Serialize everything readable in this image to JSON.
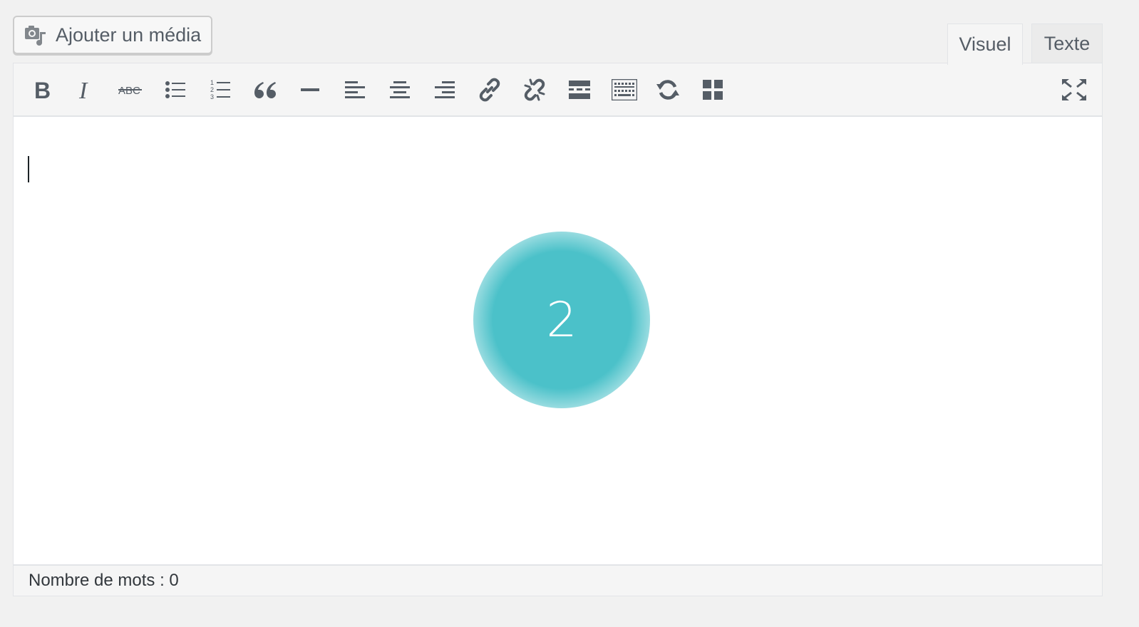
{
  "media_button": {
    "label": "Ajouter un média",
    "icon": "media-icon"
  },
  "tabs": [
    {
      "label": "Visuel",
      "active": true
    },
    {
      "label": "Texte",
      "active": false
    }
  ],
  "toolbar": {
    "buttons": [
      {
        "name": "bold",
        "icon": "bold-icon"
      },
      {
        "name": "italic",
        "icon": "italic-icon"
      },
      {
        "name": "strikethrough",
        "icon": "strikethrough-icon",
        "glyph": "ABC"
      },
      {
        "name": "bulleted-list",
        "icon": "bulleted-list-icon"
      },
      {
        "name": "numbered-list",
        "icon": "numbered-list-icon",
        "digits": [
          "1",
          "2",
          "3"
        ]
      },
      {
        "name": "blockquote",
        "icon": "quote-icon"
      },
      {
        "name": "horizontal-line",
        "icon": "horizontal-line-icon"
      },
      {
        "name": "align-left",
        "icon": "align-left-icon"
      },
      {
        "name": "align-center",
        "icon": "align-center-icon"
      },
      {
        "name": "align-right",
        "icon": "align-right-icon"
      },
      {
        "name": "insert-link",
        "icon": "link-icon"
      },
      {
        "name": "remove-link",
        "icon": "unlink-icon"
      },
      {
        "name": "read-more",
        "icon": "read-more-icon"
      },
      {
        "name": "toolbar-toggle",
        "icon": "keyboard-icon"
      },
      {
        "name": "undo-redo",
        "icon": "refresh-icon"
      },
      {
        "name": "more-blocks",
        "icon": "grid-icon"
      },
      {
        "name": "fullscreen",
        "icon": "fullscreen-icon"
      }
    ]
  },
  "hotspot": {
    "number": "2",
    "color": "#4bc1c9"
  },
  "statusbar": {
    "label": "Nombre de mots",
    "separator": " : ",
    "count": "0"
  },
  "colors": {
    "icon": "#555d66",
    "background": "#f1f1f1",
    "toolbar": "#f5f5f5",
    "border": "#e2e4e7"
  }
}
